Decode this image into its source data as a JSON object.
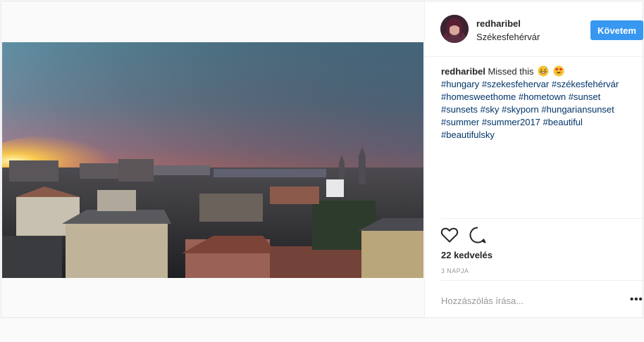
{
  "post": {
    "username": "redharibel",
    "location": "Székesfehérvár",
    "follow_label": "Követem",
    "caption_user": "redharibel",
    "caption_text": "Missed this",
    "caption_emojis": [
      "grinning-sweat-emoji",
      "heart-eyes-emoji"
    ],
    "hashtags": [
      "#hungary",
      "#szekesfehervar",
      "#székesfehérvár",
      "#homesweethome",
      "#hometown",
      "#sunset",
      "#sunsets",
      "#sky",
      "#skyporn",
      "#hungariansunset",
      "#summer",
      "#summer2017",
      "#beautiful",
      "#beautifulsky"
    ],
    "likes": "22 kedvelés",
    "time_ago": "3 NAPJA",
    "comment_placeholder": "Hozzászólás írása...",
    "more_label": "•••"
  },
  "icons": {
    "like": "heart-icon",
    "comment": "comment-icon",
    "more": "more-options-icon"
  },
  "colors": {
    "follow_button": "#3897f0",
    "hashtag": "#003569",
    "meta_text": "#999999"
  }
}
